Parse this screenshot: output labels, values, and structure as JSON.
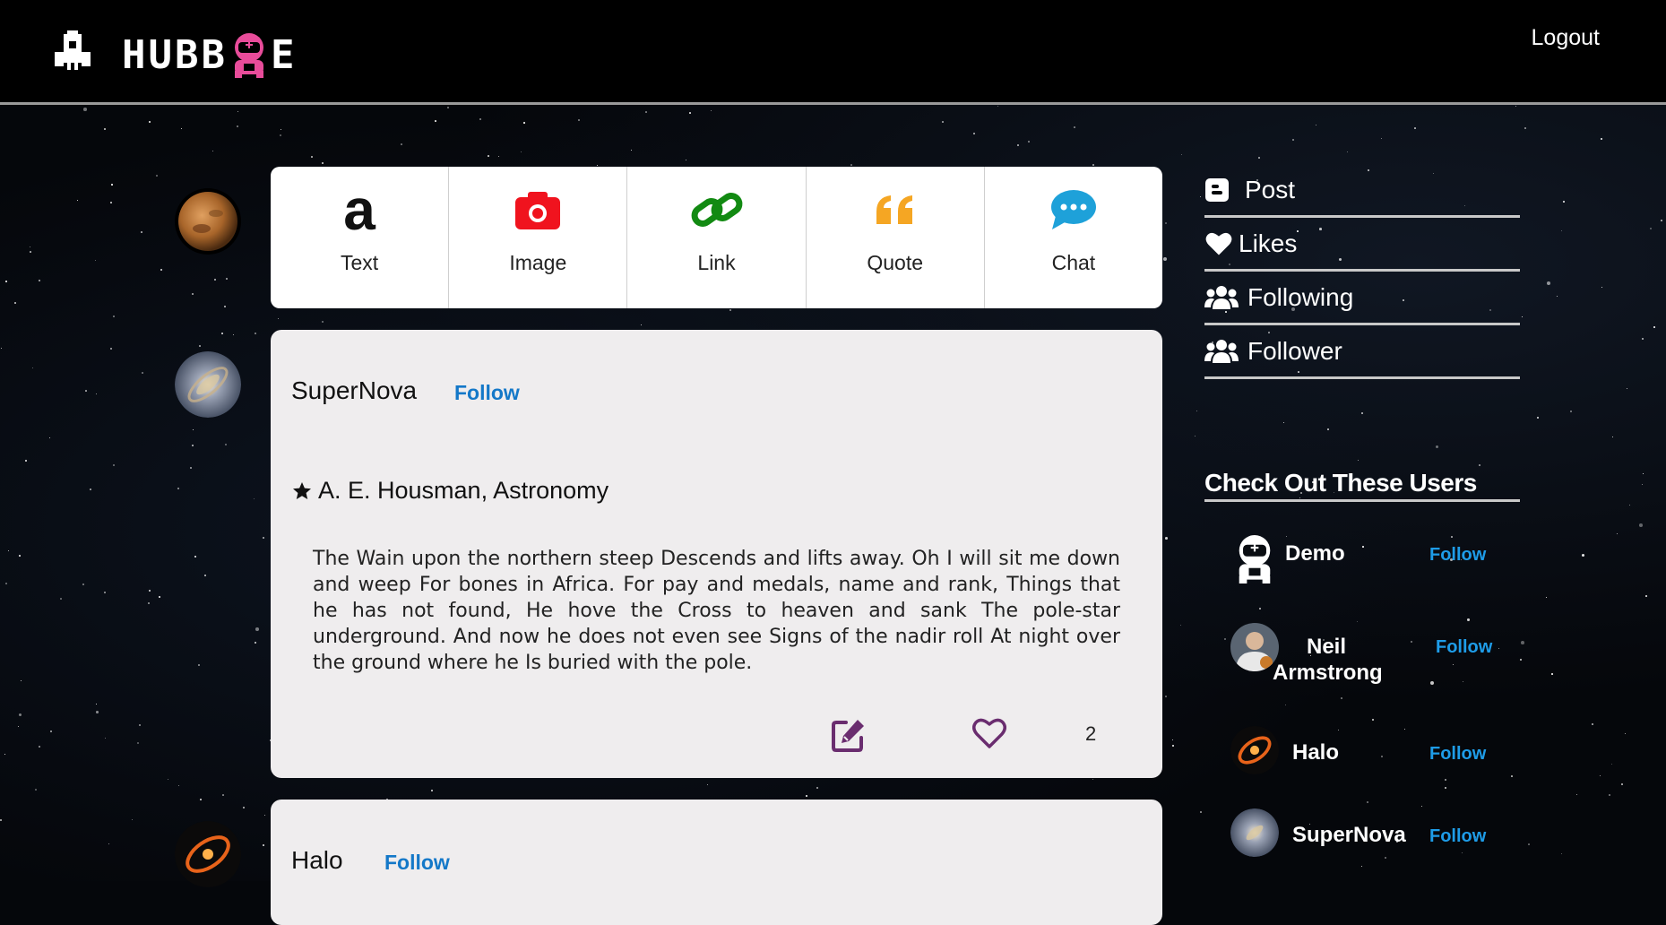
{
  "header": {
    "logo_text_left": "HUBB",
    "logo_text_right": "E",
    "logout_label": "Logout"
  },
  "composer": {
    "items": [
      {
        "label": "Text",
        "icon": "text-icon",
        "color": "#111111"
      },
      {
        "label": "Image",
        "icon": "camera-icon",
        "color": "#f0131e"
      },
      {
        "label": "Link",
        "icon": "link-icon",
        "color": "#128a12"
      },
      {
        "label": "Quote",
        "icon": "quote-icon",
        "color": "#f5a623"
      },
      {
        "label": "Chat",
        "icon": "chat-icon",
        "color": "#1ea1d9"
      }
    ]
  },
  "posts": [
    {
      "user": "SuperNova",
      "follow_label": "Follow",
      "title": "A. E. Housman, Astronomy",
      "body": "The Wain upon the northern steep Descends and lifts away. Oh I will sit me down and weep For bones in Africa. For pay and medals, name and rank, Things that he has not found, He hove the Cross to heaven and sank The pole-star underground. And now he does not even see Signs of the nadir roll At night over the ground where he Is buried with the pole.",
      "like_count": "2"
    },
    {
      "user": "Halo",
      "follow_label": "Follow"
    }
  ],
  "sidebar": {
    "nav": [
      {
        "label": "Post",
        "icon": "blogger-icon"
      },
      {
        "label": "Likes",
        "icon": "heart-icon"
      },
      {
        "label": "Following",
        "icon": "users-icon"
      },
      {
        "label": "Follower",
        "icon": "users-icon"
      }
    ],
    "suggest_title": "Check Out These Users",
    "suggestions": [
      {
        "name": "Demo",
        "follow_label": "Follow"
      },
      {
        "name": "Neil Armstrong",
        "follow_label": "Follow"
      },
      {
        "name": "Halo",
        "follow_label": "Follow"
      },
      {
        "name": "SuperNova",
        "follow_label": "Follow"
      }
    ]
  },
  "colors": {
    "accent_link": "#1478c8",
    "sidebar_follow": "#1e9ce8",
    "action_purple": "#6a2d6f",
    "logo_pink": "#e84c9a"
  }
}
